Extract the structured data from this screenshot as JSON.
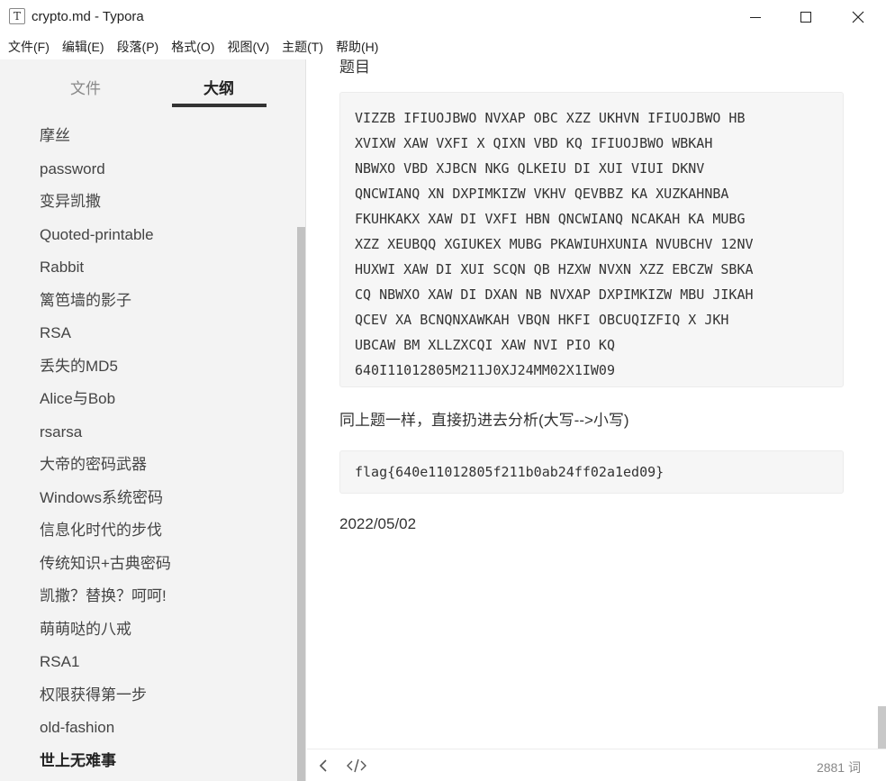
{
  "window": {
    "title": "crypto.md - Typora",
    "app_icon_glyph": "T"
  },
  "menu": [
    "文件(F)",
    "编辑(E)",
    "段落(P)",
    "格式(O)",
    "视图(V)",
    "主题(T)",
    "帮助(H)"
  ],
  "sidebar": {
    "tabs": {
      "files": "文件",
      "outline": "大纲"
    },
    "outline": [
      "摩丝",
      "password",
      "变异凯撒",
      "Quoted-printable",
      "Rabbit",
      "篱笆墙的影子",
      "RSA",
      "丢失的MD5",
      "Alice与Bob",
      "rsarsa",
      "大帝的密码武器",
      "Windows系统密码",
      "信息化时代的步伐",
      "传统知识+古典密码",
      "凯撒？替换？呵呵!",
      "萌萌哒的八戒",
      "RSA1",
      "权限获得第一步",
      "old-fashion",
      "世上无难事"
    ],
    "active_item": "世上无难事"
  },
  "editor": {
    "partial_heading": "题目",
    "cipher_lines": [
      "VIZZB IFIUOJBWO NVXAP OBC XZZ UKHVN IFIUOJBWO HB",
      "XVIXW XAW VXFI X QIXN VBD KQ IFIUOJBWO WBKAH",
      "NBWXO VBD XJBCN NKG QLKEIU DI XUI VIUI DKNV",
      "QNCWIANQ XN DXPIMKIZW VKHV QEVBBZ KA XUZKAHNBA",
      "FKUHKAKX XAW DI VXFI HBN QNCWIANQ NCAKAH KA MUBG",
      "XZZ XEUBQQ XGIUKEX MUBG PKAWIUHXUNIA NVUBCHV 12NV",
      "HUXWI XAW DI XUI SCQN QB HZXW NVXN XZZ EBCZW SBKA",
      "CQ NBWXO XAW DI DXAN NB NVXAP DXPIMKIZW MBU JIKAH",
      "QCEV XA BCNQNXAWKAH VBQN HKFI OBCUQIZFIQ X JKH",
      "UBCAW BM XLLZXCQI XAW NVI PIO KQ",
      "640I11012805M211J0XJ24MM02X1IW09"
    ],
    "paragraph": "同上题一样，直接扔进去分析(大写-->小写)",
    "flag": "flag{640e11012805f211b0ab24ff02a1ed09}",
    "date": "2022/05/02"
  },
  "footer": {
    "word_count": "2881 词"
  }
}
